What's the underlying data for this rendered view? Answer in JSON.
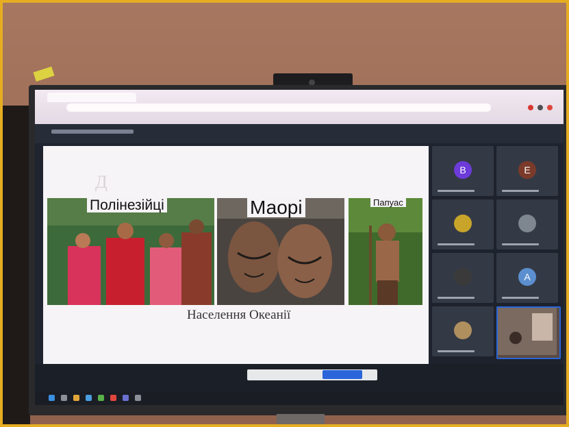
{
  "slide": {
    "labels": [
      "Полінезійці",
      "Маорі",
      "Папуас"
    ],
    "caption": "Населення Океанії"
  },
  "participants": [
    {
      "initial": "B",
      "color": "#6c3bd9"
    },
    {
      "initial": "E",
      "color": "#7b3a2a"
    },
    {
      "initial": "",
      "color": "#c8a52a"
    },
    {
      "initial": "",
      "color": "#7e8790"
    },
    {
      "initial": "",
      "color": "#3a3a3a"
    },
    {
      "initial": "A",
      "color": "#5c8fd0"
    },
    {
      "initial": "",
      "color": "#b08f5f"
    }
  ],
  "colors": {
    "frame_border": "#e6ad22",
    "wall": "#9f6d56",
    "meet_dark": "#1d222c",
    "accent_blue": "#2a66d9"
  }
}
